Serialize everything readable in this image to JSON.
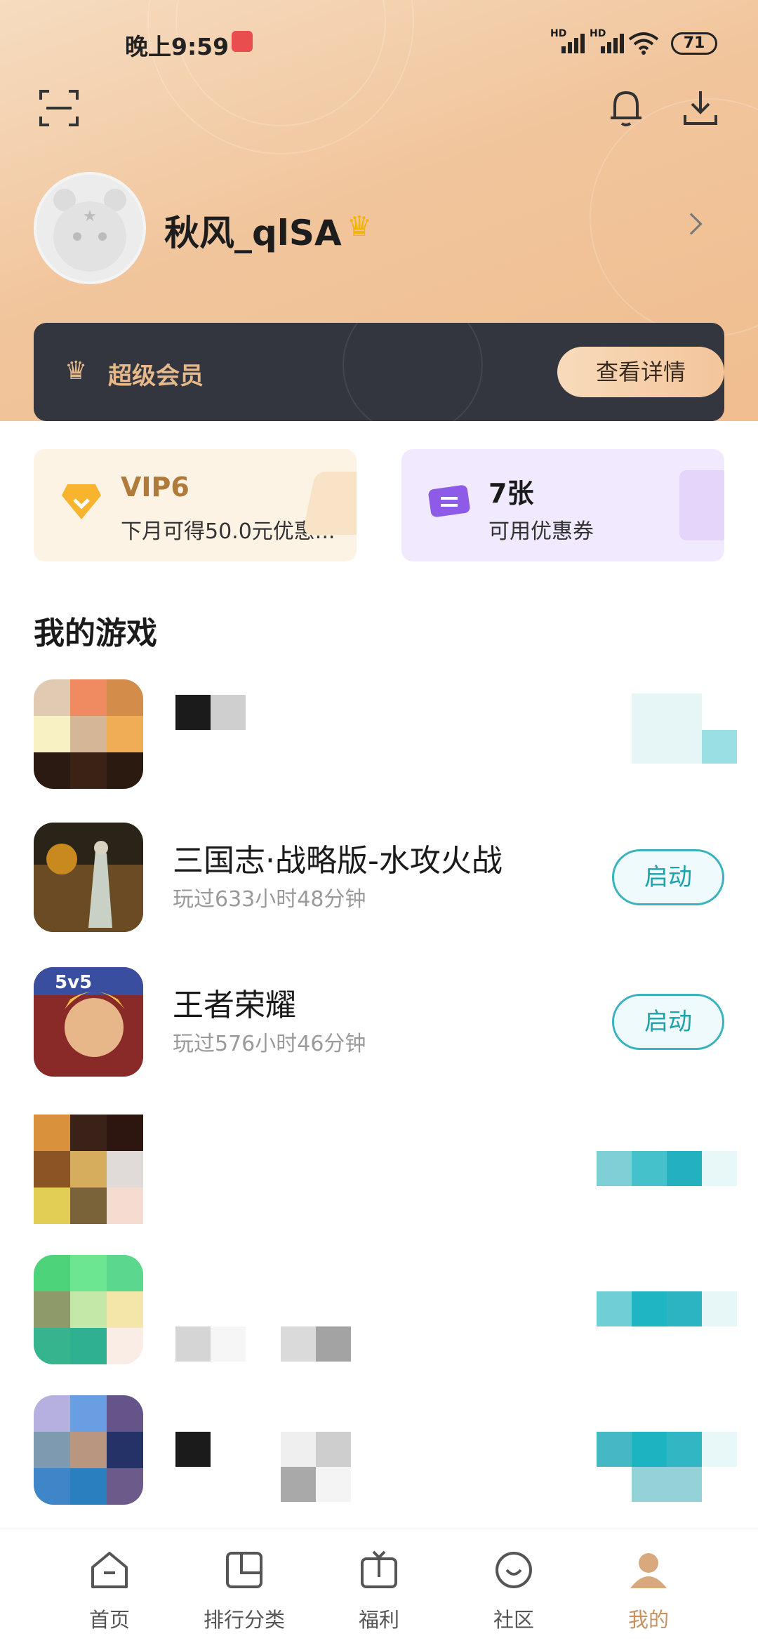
{
  "status_bar": {
    "time": "晚上9:59",
    "signal_1": "HD",
    "signal_2": "HD",
    "battery": "71"
  },
  "header": {
    "scan_icon": "scan-icon",
    "bell_icon": "bell-icon",
    "download_icon": "download-icon"
  },
  "profile": {
    "username": "秋风_qlSA",
    "crown_icon": "crown-icon"
  },
  "vip_banner": {
    "title": "超级会员",
    "button": "查看详情"
  },
  "cards": {
    "vip": {
      "title": "VIP6",
      "subtitle": "下月可得50.0元优惠..."
    },
    "coupon": {
      "title": "7张",
      "subtitle": "可用优惠券"
    }
  },
  "games_section": {
    "title": "我的游戏",
    "games": [
      {
        "name": "",
        "time": "",
        "launch": ""
      },
      {
        "name": "三国志·战略版-水攻火战",
        "time": "玩过633小时48分钟",
        "launch": "启动"
      },
      {
        "name": "王者荣耀",
        "time": "玩过576小时46分钟",
        "launch": "启动"
      },
      {
        "name": "",
        "time": "",
        "launch": ""
      },
      {
        "name": "",
        "time": "",
        "launch": ""
      },
      {
        "name": "",
        "time": "",
        "launch": ""
      }
    ]
  },
  "bottom_nav": [
    {
      "label": "首页",
      "icon": "home-icon"
    },
    {
      "label": "排行分类",
      "icon": "ranking-icon"
    },
    {
      "label": "福利",
      "icon": "gift-icon"
    },
    {
      "label": "社区",
      "icon": "community-icon"
    },
    {
      "label": "我的",
      "icon": "profile-icon",
      "active": true
    }
  ],
  "colors": {
    "accent_teal": "#39b3be",
    "header_gradient": "#f0bd8e",
    "vip_gold": "#e7b88a",
    "nav_active": "#d8a97c"
  }
}
